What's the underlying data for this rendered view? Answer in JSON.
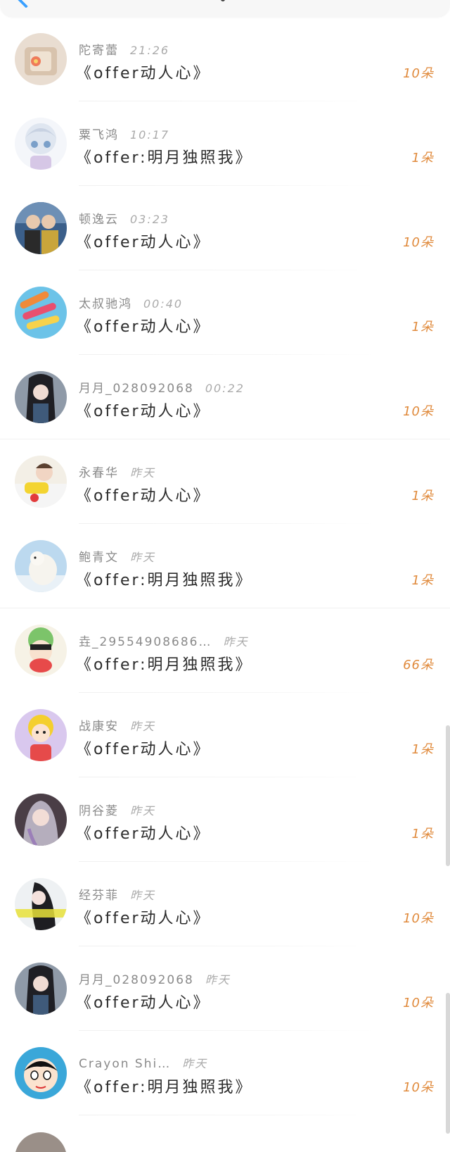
{
  "header": {
    "back_icon": "chevron-left-icon"
  },
  "rows": [
    {
      "name": "陀寄蕾",
      "time": "21:26",
      "title": "《offer动人心》",
      "count": "10朵"
    },
    {
      "name": "粟飞鸿",
      "time": "10:17",
      "title": "《offer:明月独照我》",
      "count": "1朵"
    },
    {
      "name": "顿逸云",
      "time": "03:23",
      "title": "《offer动人心》",
      "count": "10朵"
    },
    {
      "name": "太叔驰鸿",
      "time": "00:40",
      "title": "《offer动人心》",
      "count": "1朵"
    },
    {
      "name": "月月_028092068",
      "time": "00:22",
      "title": "《offer动人心》",
      "count": "10朵"
    },
    {
      "name": "永春华",
      "time": "昨天",
      "title": "《offer动人心》",
      "count": "1朵"
    },
    {
      "name": "鲍青文",
      "time": "昨天",
      "title": "《offer:明月独照我》",
      "count": "1朵"
    },
    {
      "name": "垚_29554908686…",
      "time": "昨天",
      "title": "《offer:明月独照我》",
      "count": "66朵"
    },
    {
      "name": "战康安",
      "time": "昨天",
      "title": "《offer动人心》",
      "count": "1朵"
    },
    {
      "name": "阴谷菱",
      "time": "昨天",
      "title": "《offer动人心》",
      "count": "1朵"
    },
    {
      "name": "经芬菲",
      "time": "昨天",
      "title": "《offer动人心》",
      "count": "10朵"
    },
    {
      "name": "月月_028092068",
      "time": "昨天",
      "title": "《offer动人心》",
      "count": "10朵"
    },
    {
      "name": "Crayon Shi…",
      "time": "昨天",
      "title": "《offer:明月独照我》",
      "count": "10朵"
    }
  ],
  "colors": {
    "accent": "#3aa0ff",
    "count": "#e08a3c",
    "name": "#8a8a8a",
    "title": "#2b2b2b"
  }
}
